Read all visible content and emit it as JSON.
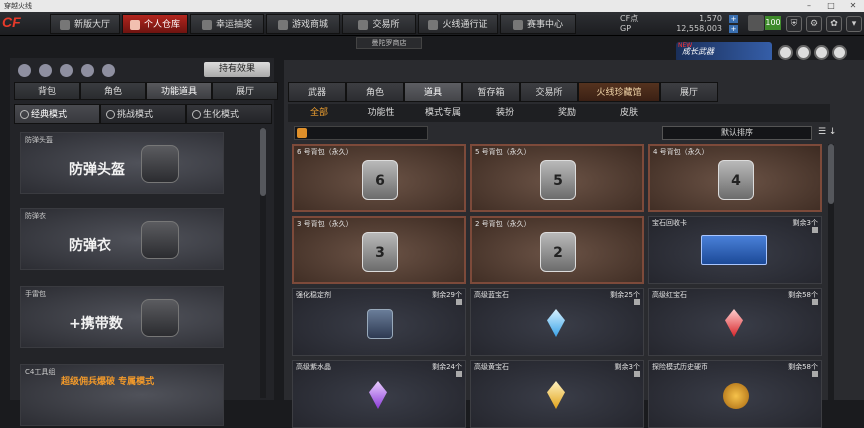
{
  "window": {
    "title": "穿越火线"
  },
  "nav": {
    "tabs": [
      {
        "label": "新版大厅"
      },
      {
        "label": "个人仓库"
      },
      {
        "label": "幸运抽奖"
      },
      {
        "label": "游戏商城"
      },
      {
        "label": "交易所"
      },
      {
        "label": "火线通行证"
      },
      {
        "label": "赛事中心"
      }
    ],
    "active": "个人仓库"
  },
  "currency": {
    "cf_label": "CF点",
    "cf_value": "1,570",
    "gp_label": "GP",
    "gp_value": "12,558,003"
  },
  "level": "100",
  "banner": {
    "sub_text": "曼陀罗商店",
    "promo_tag": "NEW",
    "promo_text": "成长武器"
  },
  "left": {
    "hold_button": "持有效果",
    "tabs": [
      "背包",
      "角色",
      "功能道具",
      "展厅"
    ],
    "modes": [
      "经典模式",
      "挑战模式",
      "生化模式"
    ],
    "equipment": [
      {
        "category": "防弹头盔",
        "name": "防弹头盔"
      },
      {
        "category": "防弹衣",
        "name": "防弹衣"
      },
      {
        "category": "手雷包",
        "name": "+携带数"
      },
      {
        "category": "C4工具组",
        "name": "超级佣兵爆破 专属模式"
      }
    ]
  },
  "right": {
    "tabs": [
      "武器",
      "角色",
      "道具",
      "暂存箱",
      "交易所",
      "火线珍藏馆",
      "展厅"
    ],
    "subtabs": [
      "全部",
      "功能性",
      "模式专属",
      "装扮",
      "奖励",
      "皮肤"
    ],
    "sort_label": "默认排序",
    "items": [
      {
        "name": "6 号背包（永久）",
        "remain": "",
        "icon": "6",
        "type": "bag"
      },
      {
        "name": "5 号背包（永久）",
        "remain": "",
        "icon": "5",
        "type": "bag"
      },
      {
        "name": "4 号背包（永久）",
        "remain": "",
        "icon": "4",
        "type": "bag"
      },
      {
        "name": "3 号背包（永久）",
        "remain": "",
        "icon": "3",
        "type": "bag"
      },
      {
        "name": "2 号背包（永久）",
        "remain": "",
        "icon": "2",
        "type": "bag"
      },
      {
        "name": "宝石回收卡",
        "remain": "剩余3个",
        "icon": "",
        "type": "card"
      },
      {
        "name": "强化稳定剂",
        "remain": "剩余29个",
        "icon": "",
        "type": "bottle"
      },
      {
        "name": "高级蓝宝石",
        "remain": "剩余25个",
        "icon": "",
        "type": "gem-blue"
      },
      {
        "name": "高级红宝石",
        "remain": "剩余58个",
        "icon": "",
        "type": "gem-red"
      },
      {
        "name": "高级紫水晶",
        "remain": "剩余24个",
        "icon": "",
        "type": "gem-purple"
      },
      {
        "name": "高级黄宝石",
        "remain": "剩余3个",
        "icon": "",
        "type": "gem-yellow"
      },
      {
        "name": "探险模式历史硬币",
        "remain": "剩余58个",
        "icon": "",
        "type": "coin"
      }
    ]
  },
  "colors": {
    "accent": "#b3261e",
    "active_sub": "#f0a030"
  }
}
